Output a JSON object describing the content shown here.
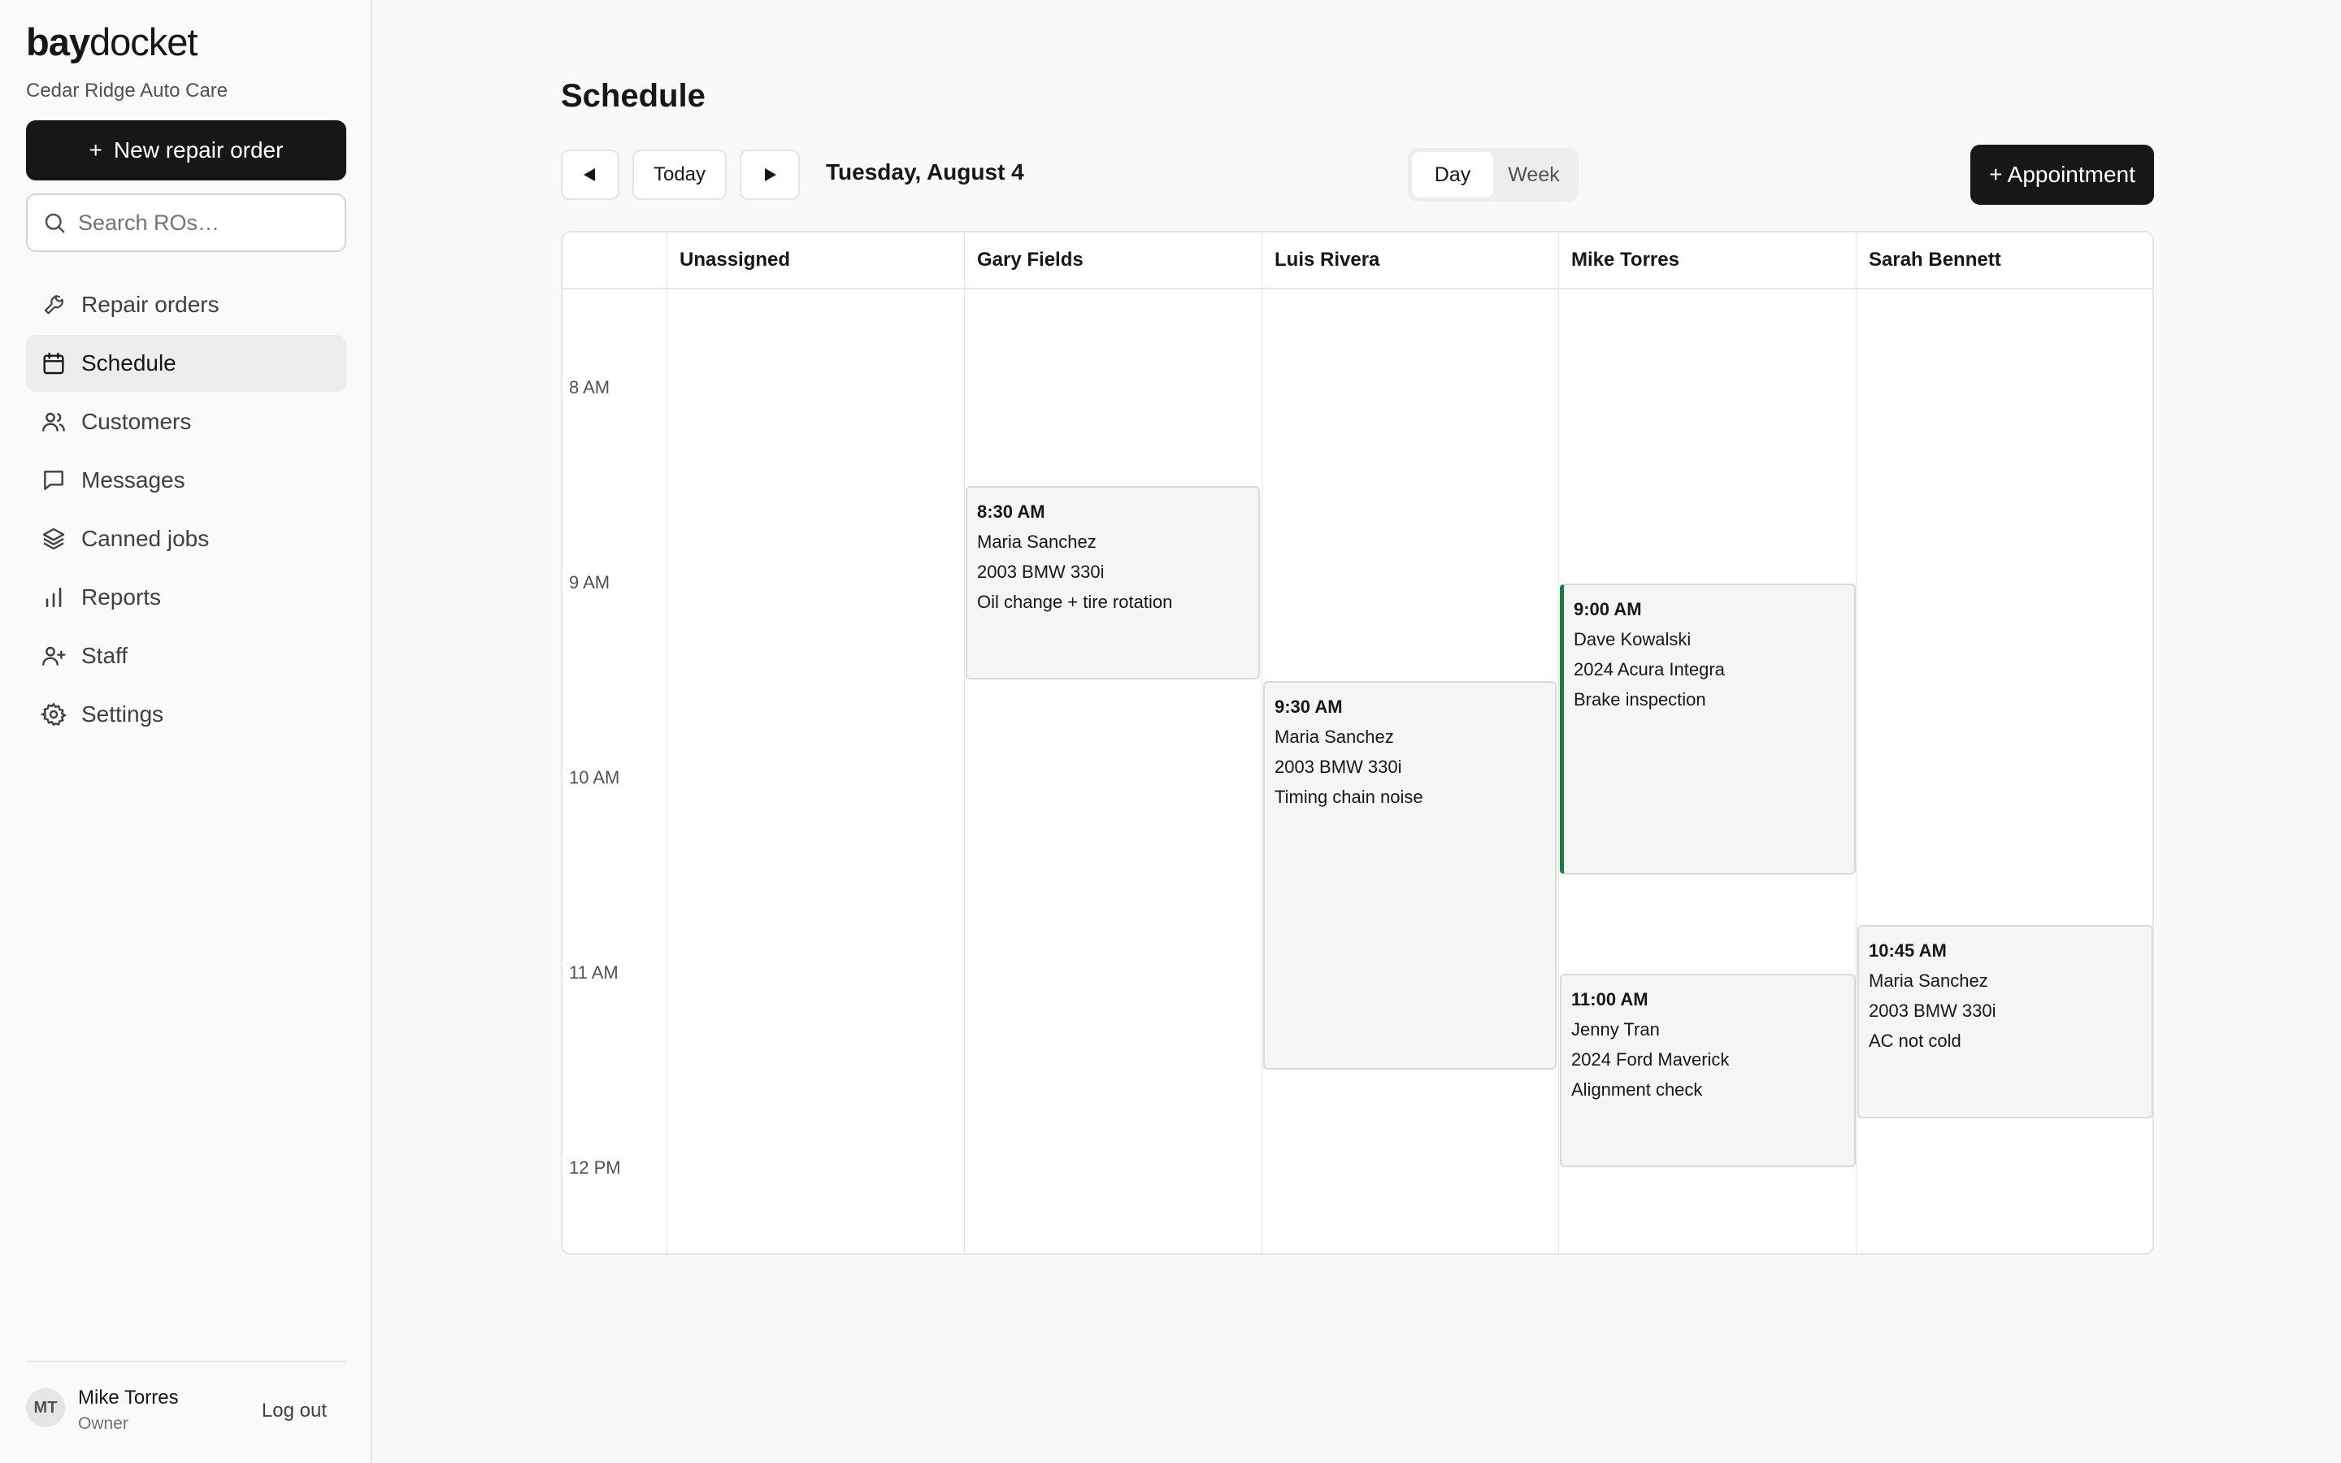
{
  "brand": {
    "bold": "bay",
    "light": "docket"
  },
  "shop_name": "Cedar Ridge Auto Care",
  "sidebar": {
    "new_button": "New repair order",
    "new_button_icon": "plus-icon",
    "search_placeholder": "Search ROs…",
    "nav": [
      {
        "label": "Repair orders",
        "icon": "wrench-icon"
      },
      {
        "label": "Schedule",
        "icon": "calendar-icon",
        "active": true
      },
      {
        "label": "Customers",
        "icon": "users-icon"
      },
      {
        "label": "Messages",
        "icon": "message-icon"
      },
      {
        "label": "Canned jobs",
        "icon": "layers-icon"
      },
      {
        "label": "Reports",
        "icon": "bar-chart-icon"
      },
      {
        "label": "Staff",
        "icon": "user-plus-icon"
      },
      {
        "label": "Settings",
        "icon": "gear-icon"
      }
    ],
    "user": {
      "initials": "MT",
      "name": "Mike Torres",
      "role": "Owner",
      "logout": "Log out"
    }
  },
  "page_title": "Schedule",
  "toolbar": {
    "prev_icon": "triangle-left-icon",
    "today": "Today",
    "next_icon": "triangle-right-icon",
    "date": "Tuesday, August 4",
    "views": [
      "Day",
      "Week"
    ],
    "active_view": "Day",
    "add_appointment": "+ Appointment"
  },
  "calendar": {
    "columns": [
      "Unassigned",
      "Gary Fields",
      "Luis Rivera",
      "Mike Torres",
      "Sarah Bennett"
    ],
    "times": [
      "8 AM",
      "9 AM",
      "10 AM",
      "11 AM",
      "12 PM"
    ],
    "appointments": [
      {
        "column": "Gary Fields",
        "time": "8:30 AM",
        "customer": "Maria Sanchez",
        "vehicle": "2003 BMW 330i",
        "service": "Oil change + tire rotation"
      },
      {
        "column": "Luis Rivera",
        "time": "9:30 AM",
        "customer": "Maria Sanchez",
        "vehicle": "2003 BMW 330i",
        "service": "Timing chain noise"
      },
      {
        "column": "Mike Torres",
        "time": "9:00 AM",
        "customer": "Dave Kowalski",
        "vehicle": "2024 Acura Integra",
        "service": "Brake inspection",
        "highlight": true,
        "highlight_color": "#15803d"
      },
      {
        "column": "Mike Torres",
        "time": "11:00 AM",
        "customer": "Jenny Tran",
        "vehicle": "2024 Ford Maverick",
        "service": "Alignment check"
      },
      {
        "column": "Sarah Bennett",
        "time": "10:45 AM",
        "customer": "Maria Sanchez",
        "vehicle": "2003 BMW 330i",
        "service": "AC not cold"
      }
    ]
  }
}
